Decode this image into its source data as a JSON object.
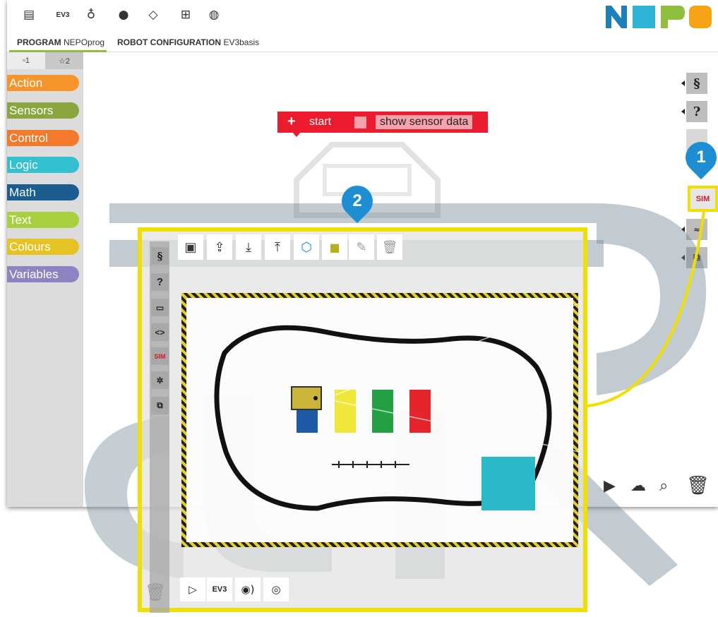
{
  "menu": {
    "icons": [
      {
        "name": "program-menu-icon",
        "glyph": "▤"
      },
      {
        "name": "robot-menu-icon",
        "glyph": "EV3"
      },
      {
        "name": "bulb-menu-icon",
        "glyph": "♁"
      },
      {
        "name": "user-menu-icon",
        "glyph": "●"
      },
      {
        "name": "gallery-menu-icon",
        "glyph": "◇"
      },
      {
        "name": "grid-menu-icon",
        "glyph": "⊞"
      },
      {
        "name": "globe-menu-icon",
        "glyph": "◍"
      }
    ],
    "ev3_label": "EV3",
    "logo_colors": [
      "#1d7fb8",
      "#2db4d6",
      "#8fbf3c",
      "#f6a318"
    ]
  },
  "tabs": {
    "program_prefix": "PROGRAM",
    "program_name": "NEPOprog",
    "robot_prefix": "ROBOT CONFIGURATION",
    "robot_name": "EV3basis"
  },
  "toolbox": {
    "level1": "▫1",
    "level2": "☆2",
    "categories": [
      {
        "label": "Action",
        "color": "#f7952a"
      },
      {
        "label": "Sensors",
        "color": "#8ba63e"
      },
      {
        "label": "Control",
        "color": "#f37a2a"
      },
      {
        "label": "Logic",
        "color": "#33c0cf"
      },
      {
        "label": "Math",
        "color": "#1b5d8f"
      },
      {
        "label": "Text",
        "color": "#a7d040"
      },
      {
        "label": "Colours",
        "color": "#e6c324"
      },
      {
        "label": "Variables",
        "color": "#8e83c1"
      }
    ]
  },
  "workspace": {
    "start_label": "start",
    "start_plus": "+",
    "show_sensor_data": "show sensor data",
    "right_buttons": [
      "§",
      "?",
      "",
      "SIM",
      "",
      ""
    ],
    "sim_label": "SIM"
  },
  "markers": {
    "one": "1",
    "two": "2"
  },
  "simulation": {
    "side_buttons": [
      "§",
      "?",
      "▭",
      "<>",
      "SIM",
      "✲",
      "⧉"
    ],
    "bottom_labels": {
      "play": "▷",
      "ev3": "EV3",
      "sound": "◉)",
      "location": "◎"
    },
    "scene_colors": [
      "#1f5aa7",
      "#f1e63a",
      "#21a144",
      "#e4262a",
      "#2ab9c9"
    ]
  }
}
